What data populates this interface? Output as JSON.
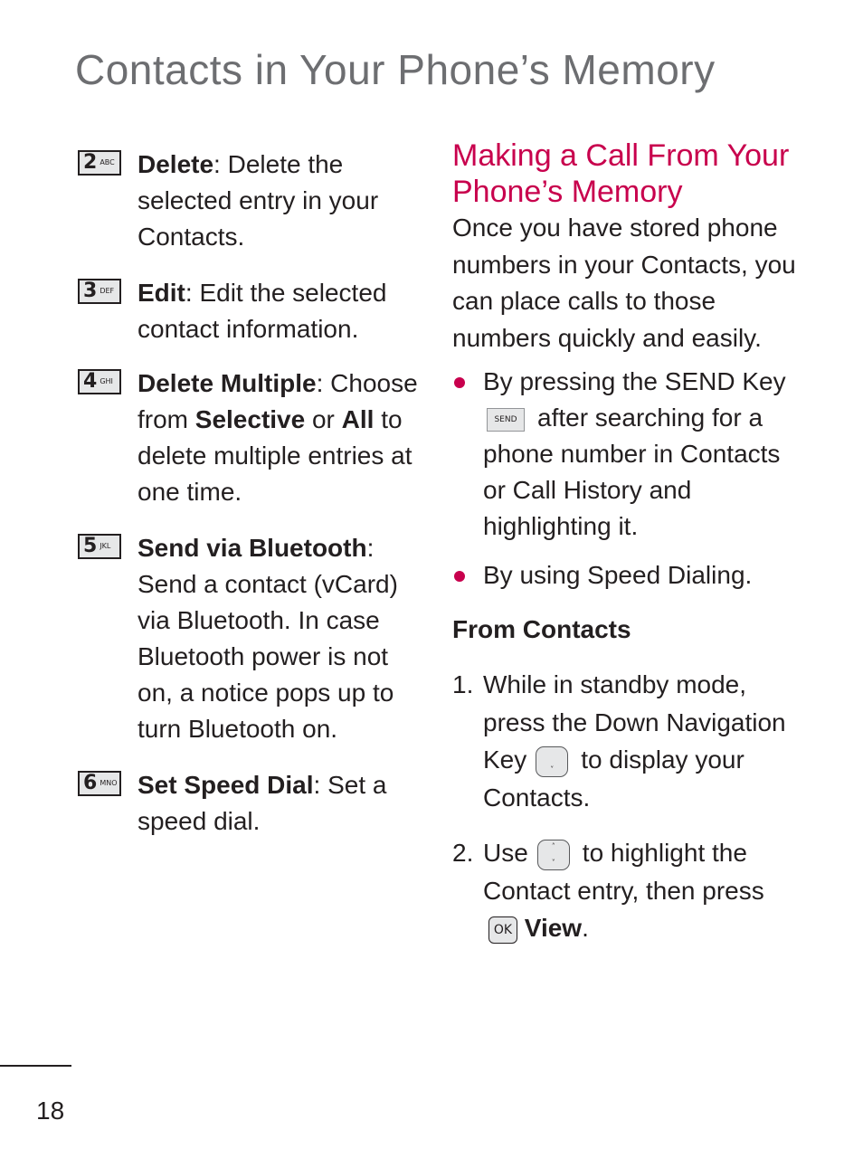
{
  "page": {
    "title": "Contacts in Your Phone’s Memory",
    "page_number": "18"
  },
  "menu_items": [
    {
      "key_num": "2",
      "key_letters": "ABC",
      "label": "Delete",
      "sep": ":",
      "desc": " Delete the selected entry in your Contacts."
    },
    {
      "key_num": "3",
      "key_letters": "DEF",
      "label": "Edit",
      "sep": ":",
      "desc": " Edit the selected contact information."
    },
    {
      "key_num": "4",
      "key_letters": "GHI",
      "label": "Delete Multiple",
      "sep": ":",
      "desc_parts": [
        " Choose from ",
        "Selective",
        " or ",
        "All",
        " to delete multiple entries at one time."
      ]
    },
    {
      "key_num": "5",
      "key_letters": "JKL",
      "label": "Send via Bluetooth",
      "sep": ":",
      "desc": " Send a contact (vCard) via Bluetooth. In case Bluetooth power is not on, a notice pops up to turn Bluetooth on."
    },
    {
      "key_num": "6",
      "key_letters": "MNO",
      "label": "Set Speed Dial",
      "sep": ":",
      "desc": " Set a speed dial."
    }
  ],
  "section": {
    "heading": "Making a Call From Your Phone’s Memory",
    "intro": "Once you have stored phone numbers in your Contacts, you can place calls to those numbers quickly and easily.",
    "bullets": [
      {
        "before": "By pressing the SEND Key",
        "key_label": "SEND",
        "after": "after searching for a phone number in Contacts or Call History and highlighting it."
      },
      {
        "text": "By using Speed Dialing."
      }
    ],
    "subheading": "From Contacts",
    "steps": [
      {
        "num": "1.",
        "before": "While in standby mode, press the Down Navigation Key",
        "after": "to display your Contacts."
      },
      {
        "num": "2.",
        "before": "Use",
        "after": "to highlight the Contact entry, then press",
        "ok_label": "OK",
        "action": "View",
        "end": "."
      }
    ],
    "nav_arrows": {
      "up": "˄",
      "down": "˅"
    }
  },
  "colors": {
    "accent": "#c8004d",
    "title_gray": "#6d6e71",
    "text": "#231f20"
  }
}
